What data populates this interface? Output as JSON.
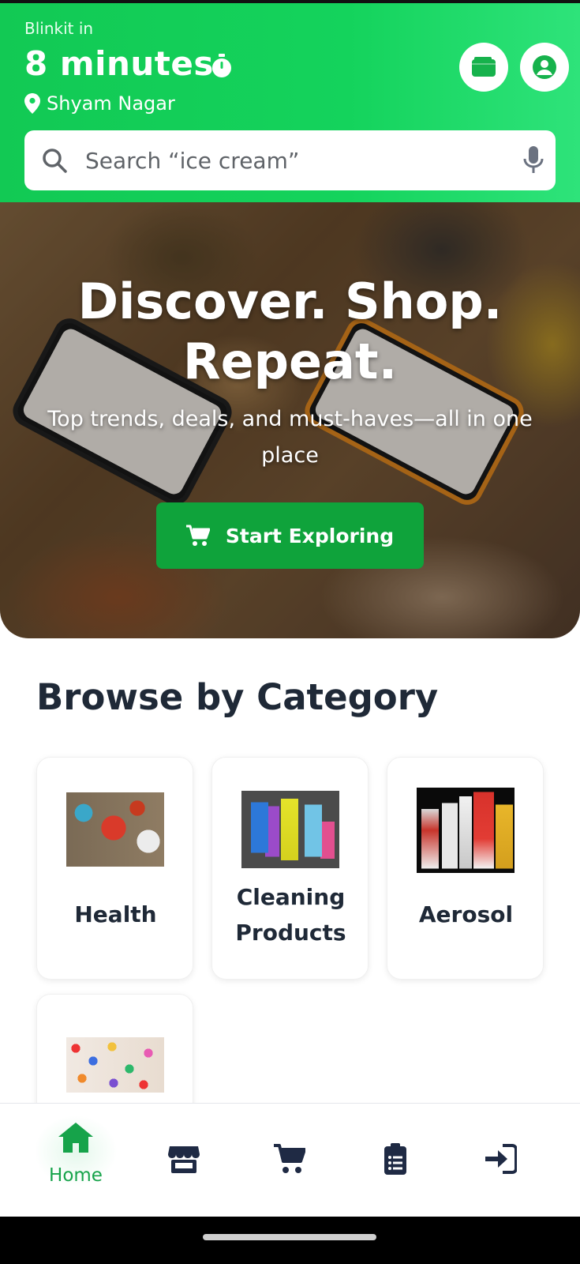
{
  "header": {
    "eta_label": "Blinkit in",
    "eta_value": "8 minutes",
    "location": "Shyam Nagar",
    "search_placeholder": "Search “ice cream”"
  },
  "hero": {
    "title": "Discover. Shop. Repeat.",
    "subtitle": "Top trends, deals, and must-haves—all in one place",
    "cta_label": "Start Exploring"
  },
  "categories": {
    "title": "Browse by Category",
    "items": [
      {
        "label": "Health"
      },
      {
        "label": "Cleaning Products"
      },
      {
        "label": "Aerosol"
      },
      {
        "label": ""
      }
    ]
  },
  "bottom_nav": {
    "items": [
      {
        "label": "Home",
        "icon": "home-icon",
        "active": true
      },
      {
        "label": "",
        "icon": "store-icon"
      },
      {
        "label": "",
        "icon": "cart-icon"
      },
      {
        "label": "",
        "icon": "orders-clipboard-icon"
      },
      {
        "label": "",
        "icon": "login-icon"
      }
    ]
  },
  "colors": {
    "brand_green": "#14d35c",
    "cta_green": "#0fa33b",
    "active_nav": "#16a34a",
    "heading": "#1f2937",
    "icon_dark": "#1f2a44"
  }
}
